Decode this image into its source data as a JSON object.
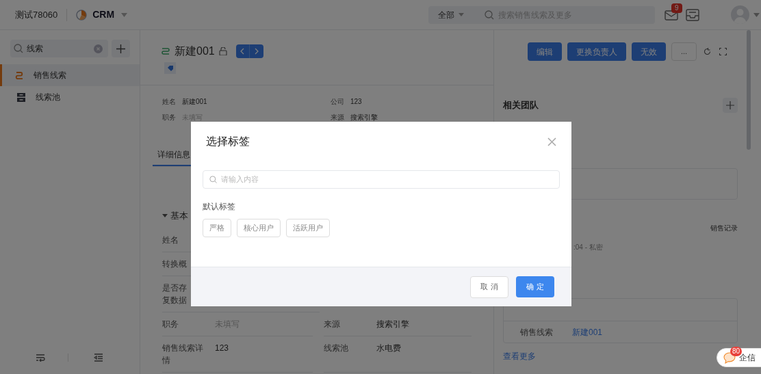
{
  "topbar": {
    "account": "测试78060",
    "app": "CRM",
    "scope": "全部",
    "search_placeholder": "搜索销售线索及更多",
    "mail_badge": "9"
  },
  "sidebar": {
    "search_value": "线索",
    "items": [
      {
        "label": "销售线索",
        "kind": "lead",
        "selected": true
      },
      {
        "label": "线索池",
        "kind": "pool",
        "selected": false
      }
    ]
  },
  "record": {
    "title": "新建001",
    "buttons": [
      "编辑",
      "更换负责人",
      "无效"
    ],
    "more": "...",
    "summary": [
      {
        "label": "姓名",
        "value": "新建001",
        "empty": false
      },
      {
        "label": "公司",
        "value": "123",
        "empty": false
      },
      {
        "label": "职务",
        "value": "未填写",
        "empty": true
      },
      {
        "label": "来源",
        "value": "搜索引擎",
        "empty": false
      }
    ]
  },
  "tabs": [
    {
      "label": "详细信息",
      "selected": true
    }
  ],
  "section": {
    "title": "基本"
  },
  "fields": [
    {
      "cells": [
        {
          "label_lines": [
            "姓名"
          ]
        }
      ]
    },
    {
      "cells": [
        {
          "label_lines": [
            "转换概"
          ]
        }
      ]
    },
    {
      "cells": [
        {
          "label_lines": [
            "是否存",
            "复数据"
          ]
        }
      ]
    },
    {
      "cells": [
        {
          "label_lines": [
            "职务"
          ],
          "value": "未填写",
          "empty": true
        },
        {
          "label_lines": [
            "来源"
          ],
          "value": "搜索引擎",
          "empty": false
        }
      ]
    },
    {
      "cells": [
        {
          "label_lines": [
            "销售线索详",
            "情"
          ],
          "value": "123",
          "empty": false
        },
        {
          "label_lines": [
            "线索池"
          ],
          "value": "水电费",
          "empty": false
        }
      ]
    }
  ],
  "side_panel": {
    "team_title": "相关团队",
    "record_tab": "销售记录",
    "activity": ":04 - 私密",
    "related": [
      {
        "label": "销售线索",
        "value": "新建001"
      }
    ],
    "more_link": "查看更多"
  },
  "dialog": {
    "title": "选择标签",
    "search_placeholder": "请输入内容",
    "group": "默认标签",
    "tags": [
      "严格",
      "核心用户",
      "活跃用户"
    ],
    "cancel": "取 消",
    "confirm": "确 定"
  },
  "chat": {
    "label": "企信",
    "badge": "80"
  }
}
